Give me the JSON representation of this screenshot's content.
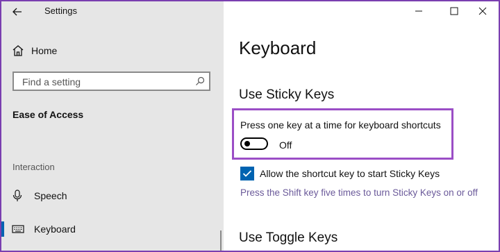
{
  "window": {
    "title": "Settings",
    "controls": {
      "minimize": "minimize-icon",
      "maximize": "maximize-icon",
      "close": "close-icon"
    }
  },
  "sidebar": {
    "home_label": "Home",
    "search": {
      "placeholder": "Find a setting",
      "value": ""
    },
    "section_title": "Ease of Access",
    "group_label": "Interaction",
    "items": [
      {
        "label": "Speech",
        "icon": "microphone-icon",
        "active": false
      },
      {
        "label": "Keyboard",
        "icon": "keyboard-icon",
        "active": true
      }
    ]
  },
  "main": {
    "page_title": "Keyboard",
    "sticky_keys": {
      "heading": "Use Sticky Keys",
      "description": "Press one key at a time for keyboard shortcuts",
      "toggle_state": "Off",
      "checkbox_label": "Allow the shortcut key to start Sticky Keys",
      "checkbox_checked": true,
      "hint": "Press the Shift key five times to turn Sticky Keys on or off"
    },
    "toggle_keys": {
      "heading": "Use Toggle Keys"
    }
  },
  "colors": {
    "accent": "#0063b1",
    "highlight_border": "#9b4ec6",
    "window_border": "#7a3fb0",
    "sidebar_bg": "#e6e6e6"
  }
}
